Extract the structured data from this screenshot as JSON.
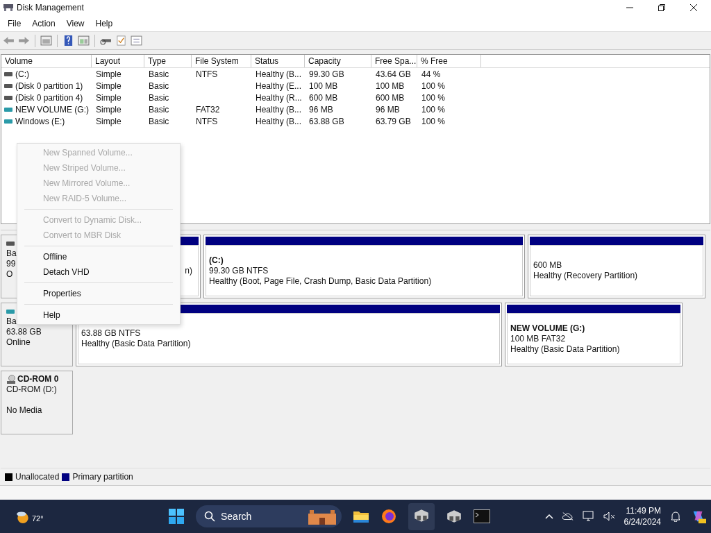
{
  "window": {
    "title": "Disk Management"
  },
  "menu_bar": [
    "File",
    "Action",
    "View",
    "Help"
  ],
  "volume_table": {
    "columns": [
      "Volume",
      "Layout",
      "Type",
      "File System",
      "Status",
      "Capacity",
      "Free Spa...",
      "% Free"
    ],
    "rows": [
      {
        "kind": "system",
        "cells": [
          "(C:)",
          "Simple",
          "Basic",
          "NTFS",
          "Healthy (B...",
          "99.30 GB",
          "43.64 GB",
          "44 %"
        ]
      },
      {
        "kind": "system",
        "cells": [
          "(Disk 0 partition 1)",
          "Simple",
          "Basic",
          "",
          "Healthy (E...",
          "100 MB",
          "100 MB",
          "100 %"
        ]
      },
      {
        "kind": "system",
        "cells": [
          "(Disk 0 partition 4)",
          "Simple",
          "Basic",
          "",
          "Healthy (R...",
          "600 MB",
          "600 MB",
          "100 %"
        ]
      },
      {
        "kind": "removable",
        "cells": [
          "NEW VOLUME (G:)",
          "Simple",
          "Basic",
          "FAT32",
          "Healthy (B...",
          "96 MB",
          "96 MB",
          "100 %"
        ]
      },
      {
        "kind": "removable",
        "cells": [
          "Windows (E:)",
          "Simple",
          "Basic",
          "NTFS",
          "Healthy (B...",
          "63.88 GB",
          "63.79 GB",
          "100 %"
        ]
      }
    ]
  },
  "disks": [
    {
      "kind": "system",
      "lines": [
        "Ba",
        "99",
        "O"
      ],
      "partitions": [
        {
          "lines": [
            "n)"
          ]
        },
        {
          "title": "(C:)",
          "lines": [
            "99.30 GB NTFS",
            "Healthy (Boot, Page File, Crash Dump, Basic Data Partition)"
          ]
        },
        {
          "lines": [
            "600 MB",
            "Healthy (Recovery Partition)"
          ]
        }
      ]
    },
    {
      "kind": "removable",
      "lines": [
        "Ba",
        "63.88 GB",
        "Online"
      ],
      "partitions": [
        {
          "lines": [
            "63.88 GB NTFS",
            "Healthy (Basic Data Partition)"
          ]
        },
        {
          "title": "NEW VOLUME  (G:)",
          "lines": [
            "100 MB FAT32",
            "Healthy (Basic Data Partition)"
          ]
        }
      ]
    },
    {
      "kind": "cdrom",
      "name": "CD-ROM 0",
      "lines": [
        "CD-ROM (D:)",
        "No Media"
      ]
    }
  ],
  "legend": [
    {
      "label": "Unallocated",
      "color": "#000000"
    },
    {
      "label": "Primary partition",
      "color": "#000080"
    }
  ],
  "context_menu": [
    {
      "kind": "item",
      "label": "New Spanned Volume...",
      "disabled": true
    },
    {
      "kind": "item",
      "label": "New Striped Volume...",
      "disabled": true
    },
    {
      "kind": "item",
      "label": "New Mirrored Volume...",
      "disabled": true
    },
    {
      "kind": "item",
      "label": "New RAID-5 Volume...",
      "disabled": true
    },
    {
      "kind": "separator"
    },
    {
      "kind": "item",
      "label": "Convert to Dynamic Disk...",
      "disabled": true
    },
    {
      "kind": "item",
      "label": "Convert to MBR Disk",
      "disabled": true
    },
    {
      "kind": "separator"
    },
    {
      "kind": "item",
      "label": "Offline",
      "disabled": false
    },
    {
      "kind": "item",
      "label": "Detach VHD",
      "disabled": false
    },
    {
      "kind": "separator"
    },
    {
      "kind": "item",
      "label": "Properties",
      "disabled": false
    },
    {
      "kind": "separator"
    },
    {
      "kind": "item",
      "label": "Help",
      "disabled": false
    }
  ],
  "taskbar": {
    "weather": "72°",
    "search": {
      "label": "Search"
    },
    "time": "11:49 PM",
    "date": "6/24/2024"
  }
}
